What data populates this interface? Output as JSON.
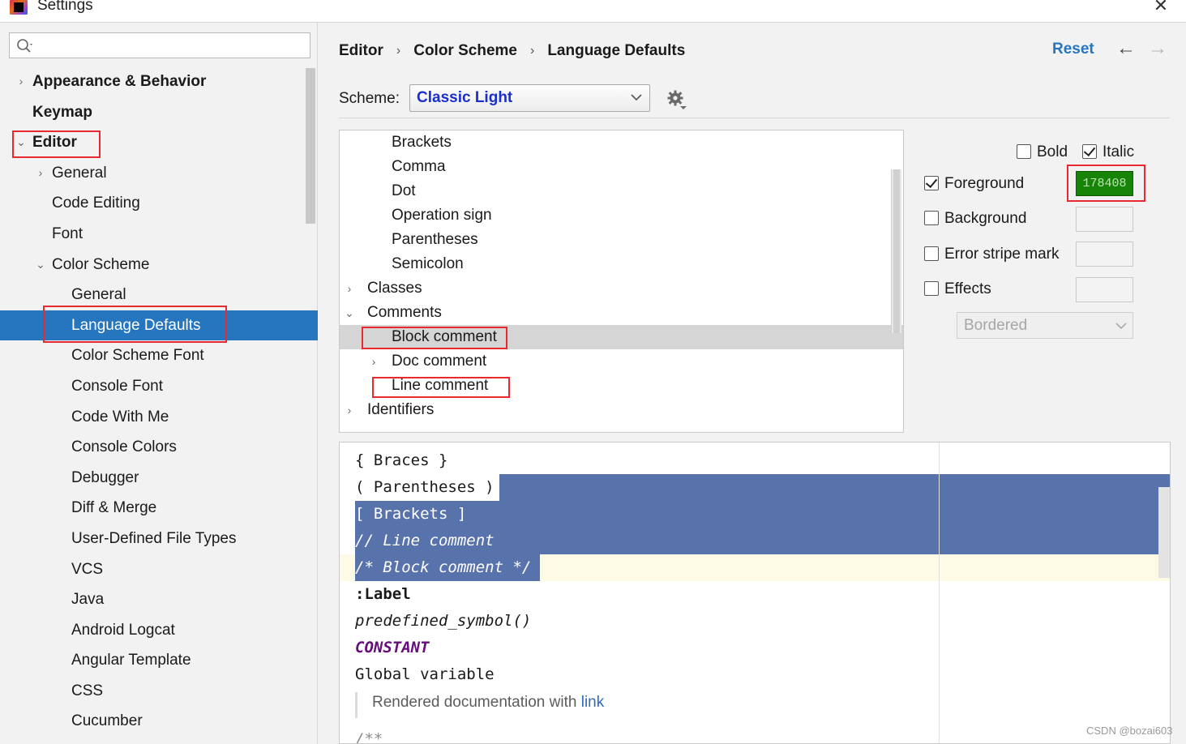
{
  "window": {
    "title": "Settings"
  },
  "search": {
    "value": "",
    "placeholder": ""
  },
  "sidebar": {
    "items": [
      {
        "label": "Appearance & Behavior"
      },
      {
        "label": "Keymap"
      },
      {
        "label": "Editor"
      },
      {
        "label": "General"
      },
      {
        "label": "Code Editing"
      },
      {
        "label": "Font"
      },
      {
        "label": "Color Scheme"
      },
      {
        "label": "General"
      },
      {
        "label": "Language Defaults"
      },
      {
        "label": "Color Scheme Font"
      },
      {
        "label": "Console Font"
      },
      {
        "label": "Code With Me"
      },
      {
        "label": "Console Colors"
      },
      {
        "label": "Debugger"
      },
      {
        "label": "Diff & Merge"
      },
      {
        "label": "User-Defined File Types"
      },
      {
        "label": "VCS"
      },
      {
        "label": "Java"
      },
      {
        "label": "Android Logcat"
      },
      {
        "label": "Angular Template"
      },
      {
        "label": "CSS"
      },
      {
        "label": "Cucumber"
      }
    ],
    "selected": "Language Defaults"
  },
  "breadcrumb": {
    "items": [
      "Editor",
      "Color Scheme",
      "Language Defaults"
    ],
    "separator": "›"
  },
  "header": {
    "reset": "Reset",
    "back_icon": "←",
    "forward_icon": "→"
  },
  "scheme": {
    "label": "Scheme:",
    "value": "Classic Light"
  },
  "element_tree": {
    "items": [
      {
        "label": "Brackets"
      },
      {
        "label": "Comma"
      },
      {
        "label": "Dot"
      },
      {
        "label": "Operation sign"
      },
      {
        "label": "Parentheses"
      },
      {
        "label": "Semicolon"
      },
      {
        "label": "Classes"
      },
      {
        "label": "Comments"
      },
      {
        "label": "Block comment"
      },
      {
        "label": "Doc comment"
      },
      {
        "label": "Line comment"
      },
      {
        "label": "Identifiers"
      }
    ],
    "selected": "Block comment"
  },
  "attributes": {
    "bold": {
      "label": "Bold",
      "checked": false
    },
    "italic": {
      "label": "Italic",
      "checked": true
    },
    "foreground": {
      "label": "Foreground",
      "checked": true,
      "color": "178408"
    },
    "background": {
      "label": "Background",
      "checked": false
    },
    "error_stripe": {
      "label": "Error stripe mark",
      "checked": false
    },
    "effects": {
      "label": "Effects",
      "checked": false,
      "style": "Bordered"
    }
  },
  "preview": {
    "lines": [
      "{ Braces }",
      "( Parentheses )",
      "[ Brackets ]",
      "// Line comment",
      "/* Block comment */",
      ":Label",
      "predefined_symbol()",
      "CONSTANT",
      "Global variable"
    ],
    "doc_text": "Rendered documentation with ",
    "doc_link": "link",
    "last_line": "/**"
  },
  "colors": {
    "accent": "#2675bf",
    "selection": "#5873ab",
    "caret_row": "#fdfae6",
    "highlight_box": "#e8292f",
    "foreground_swatch": "#178408",
    "scheme_text": "#1a2fc9",
    "constant": "#660e7a"
  },
  "watermark": "CSDN @bozai603"
}
